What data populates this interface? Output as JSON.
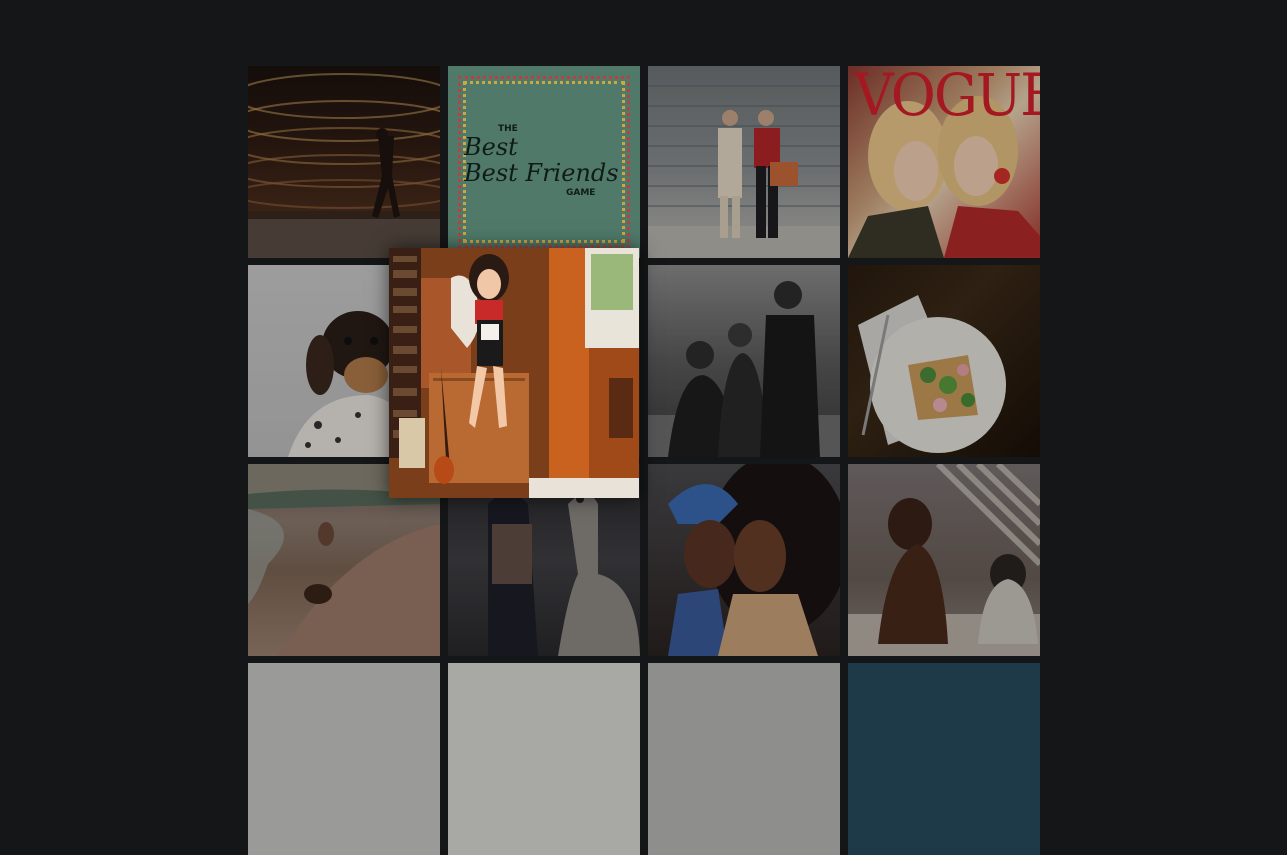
{
  "gallery": {
    "vogue_masthead": "VOGUE",
    "game_card": {
      "line1": "THE",
      "line2": "Best",
      "line3": "Best Friends",
      "line4": "GAME"
    },
    "tiles": [
      {
        "name": "opera-stage-photo",
        "icon": "photo"
      },
      {
        "name": "best-friends-game-cover",
        "icon": "photo"
      },
      {
        "name": "couple-street-photo",
        "icon": "photo"
      },
      {
        "name": "vogue-cover-photo",
        "icon": "photo"
      },
      {
        "name": "dachshund-portrait-photo",
        "icon": "photo"
      },
      {
        "name": "woman-on-cabinet-photo",
        "icon": "photo"
      },
      {
        "name": "family-portrait-photo",
        "icon": "photo"
      },
      {
        "name": "toast-plate-photo",
        "icon": "photo"
      },
      {
        "name": "beach-dogs-photo",
        "icon": "photo"
      },
      {
        "name": "man-with-llama-photo",
        "icon": "photo"
      },
      {
        "name": "two-women-photo",
        "icon": "photo"
      },
      {
        "name": "two-dachshunds-photo",
        "icon": "photo"
      }
    ],
    "colors": {
      "background": "#151617",
      "vogue_red": "#d21f2b",
      "game_green": "#5c8a78"
    }
  }
}
